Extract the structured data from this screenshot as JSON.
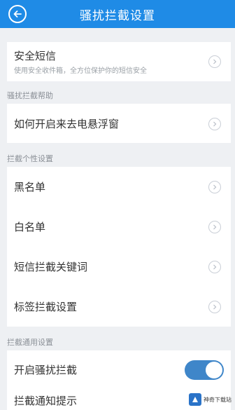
{
  "header": {
    "title": "骚扰拦截设置",
    "back_icon": "back-arrow-icon",
    "color": "#1f8be6"
  },
  "secure_sms": {
    "title": "安全短信",
    "subtitle": "使用安全收件箱，全方位保护你的短信安全"
  },
  "sections": {
    "help": "骚扰拦截帮助",
    "personal": "拦截个性设置",
    "general": "拦截通用设置"
  },
  "help_items": [
    "如何开启来去电悬浮窗"
  ],
  "personal_items": [
    "黑名单",
    "白名单",
    "短信拦截关键词",
    "标签拦截设置"
  ],
  "general_items": {
    "enable_label": "开启骚扰拦截",
    "enable_on": true,
    "notify_label": "拦截通知提示"
  },
  "watermark": {
    "text": "神奇下载站"
  }
}
